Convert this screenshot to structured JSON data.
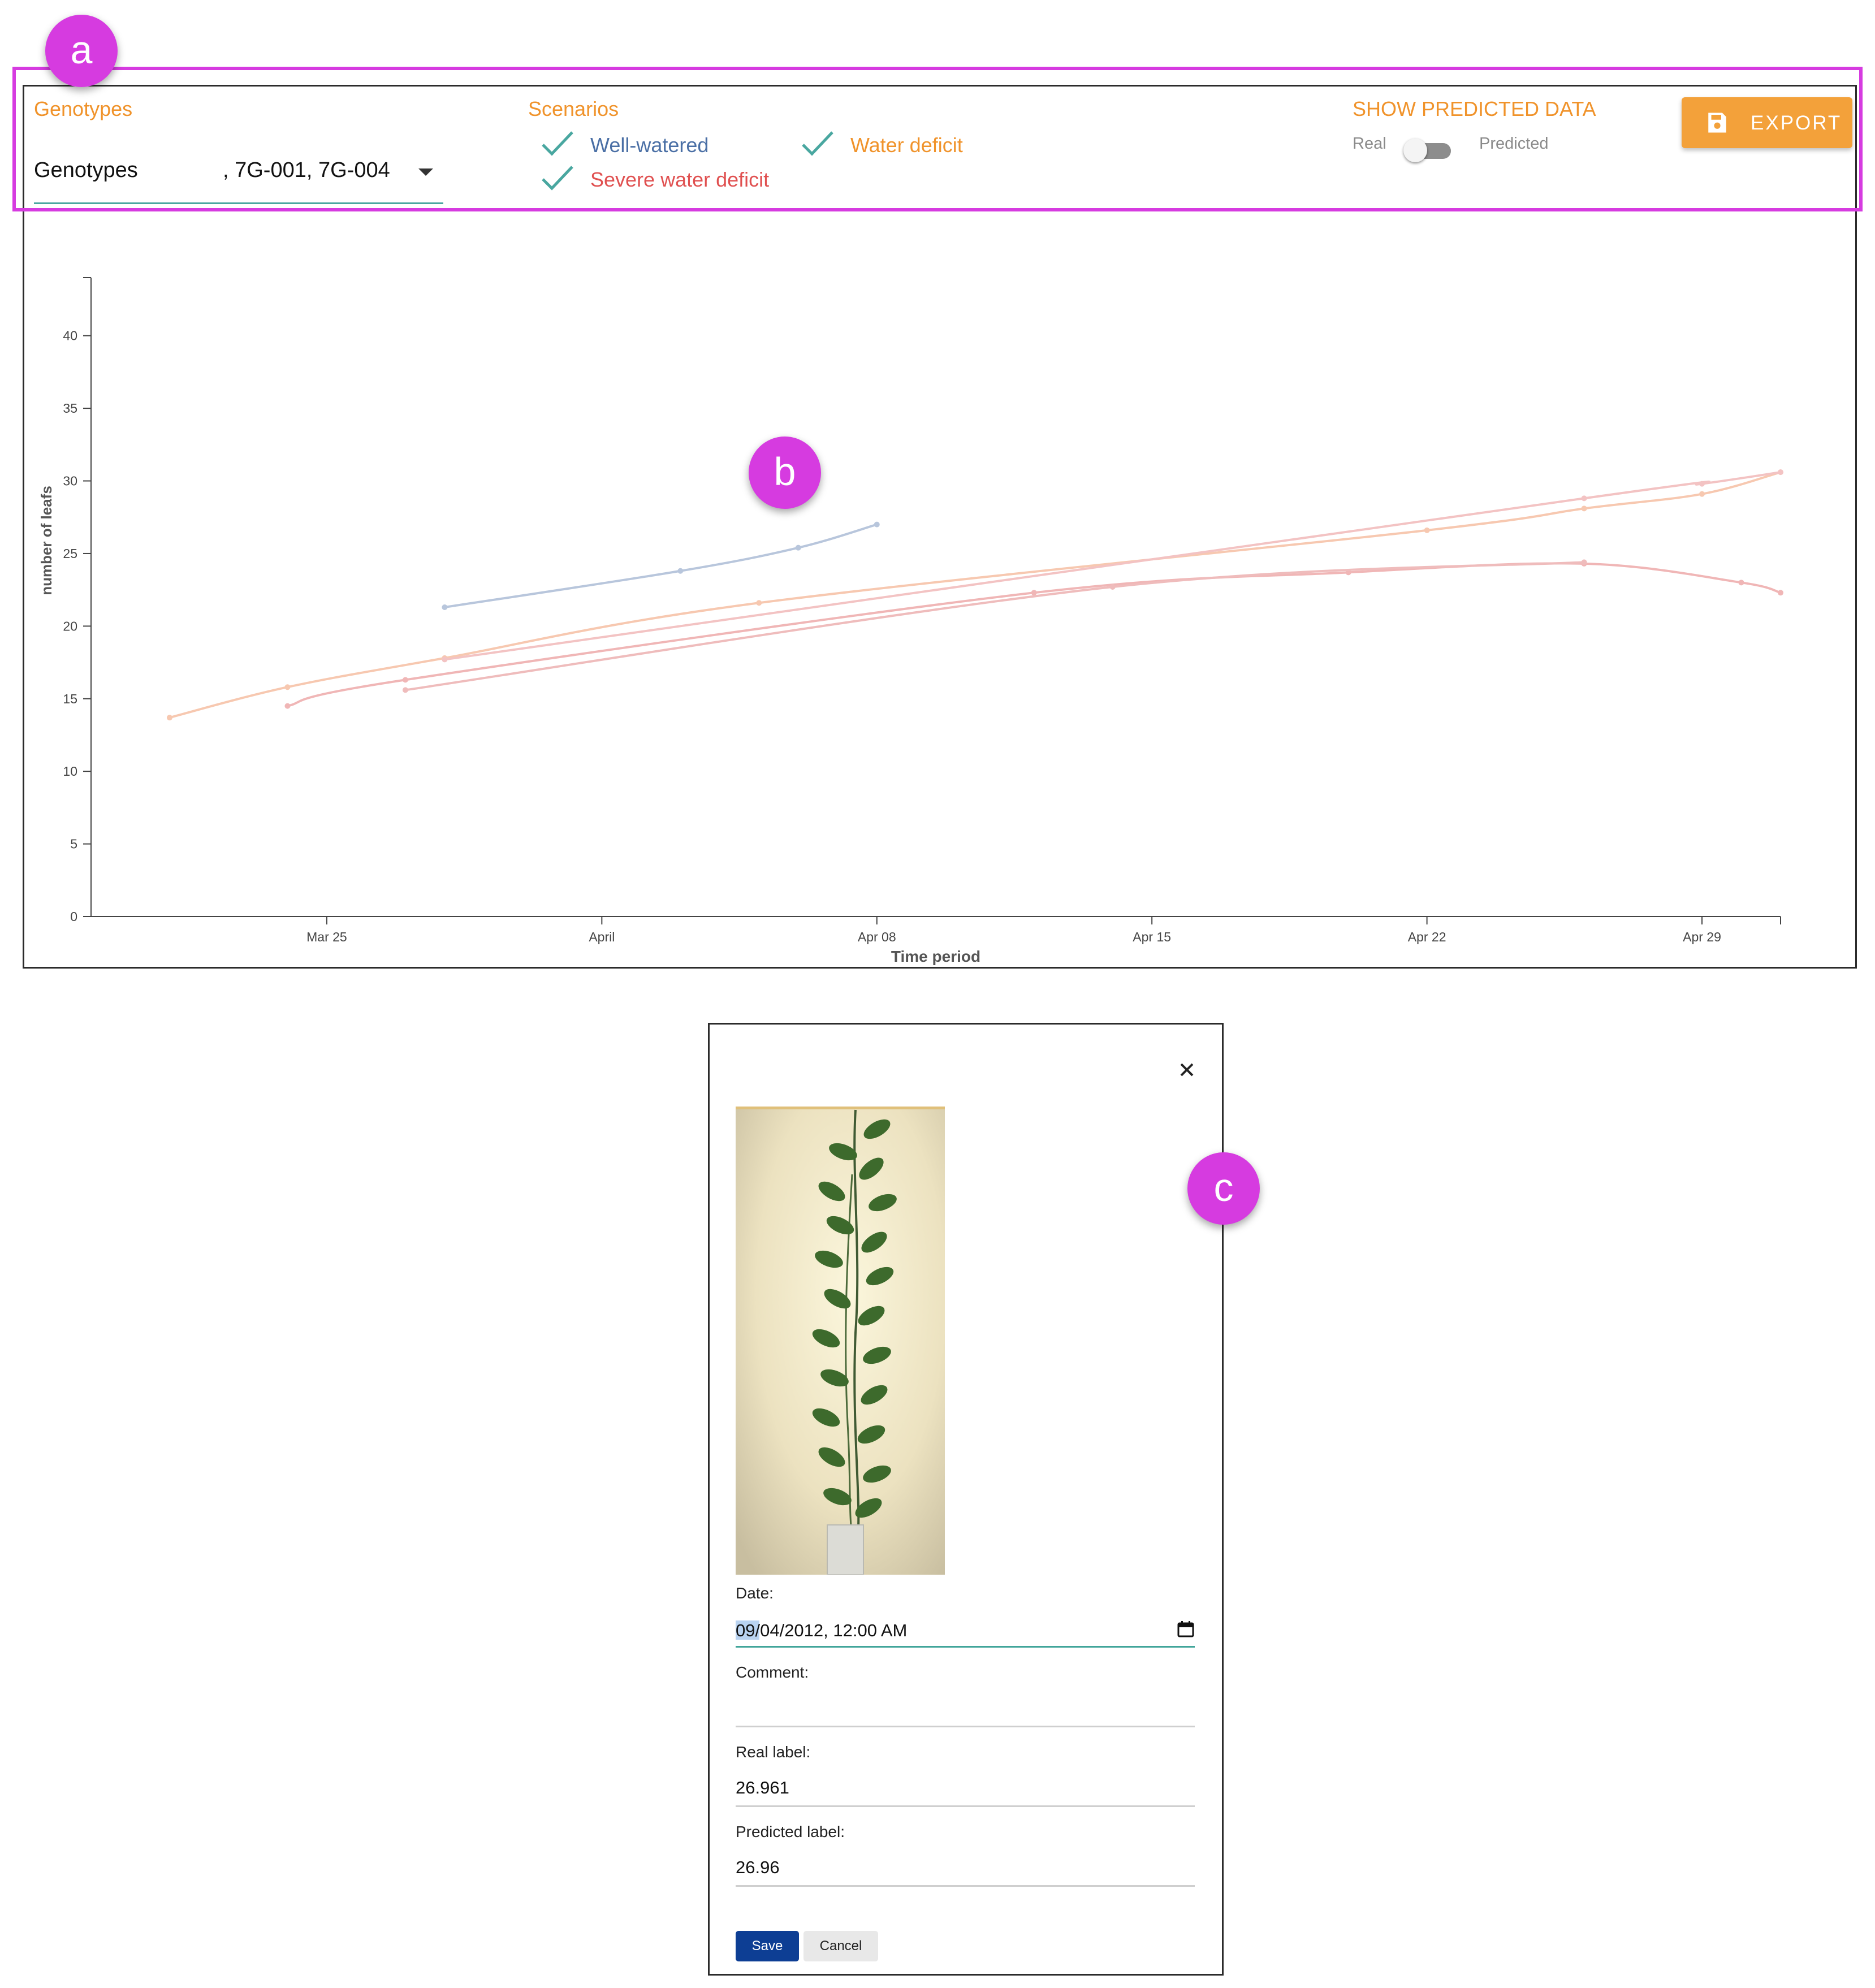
{
  "markers": {
    "a": "a",
    "b": "b",
    "c": "c"
  },
  "controls": {
    "genotypes_label": "Genotypes",
    "genotype_select": {
      "value_prefix": "Genotypes",
      "value_rest": ", 7G-001, 7G-004"
    },
    "scenarios_label": "Scenarios",
    "scenarios": [
      {
        "label": "Well-watered",
        "color": "#4a6fa5",
        "checked": true
      },
      {
        "label": "Water deficit",
        "color": "#f0932b",
        "checked": true
      },
      {
        "label": "Severe water deficit",
        "color": "#e05050",
        "checked": true
      }
    ],
    "predicted_title": "SHOW PREDICTED DATA",
    "toggle_left": "Real",
    "toggle_right": "Predicted",
    "toggle_on": false,
    "export_label": "EXPORT"
  },
  "chart_data": {
    "type": "line",
    "xlabel": "Time period",
    "ylabel": "number of leafs",
    "ylim": [
      0,
      44
    ],
    "yticks": [
      0,
      5,
      10,
      15,
      20,
      25,
      30,
      35,
      40
    ],
    "xlim": [
      "2012-03-19",
      "2012-05-01"
    ],
    "xticks": [
      {
        "date": "2012-03-25",
        "label": "Mar 25"
      },
      {
        "date": "2012-04-01",
        "label": "April"
      },
      {
        "date": "2012-04-08",
        "label": "Apr 08"
      },
      {
        "date": "2012-04-15",
        "label": "Apr 15"
      },
      {
        "date": "2012-04-22",
        "label": "Apr 22"
      },
      {
        "date": "2012-04-29",
        "label": "Apr 29"
      }
    ],
    "series": [
      {
        "color": "#b8c6dc",
        "points": [
          [
            "2012-03-28",
            21.3
          ],
          [
            "2012-04-03",
            23.8
          ],
          [
            "2012-04-06",
            25.4
          ],
          [
            "2012-04-08",
            27.0
          ]
        ]
      },
      {
        "color": "#f7c8b0",
        "points": [
          [
            "2012-03-21",
            13.7
          ],
          [
            "2012-03-24",
            15.8
          ],
          [
            "2012-03-28",
            17.8
          ],
          [
            "2012-04-05",
            21.6
          ],
          [
            "2012-04-22",
            26.6
          ],
          [
            "2012-04-26",
            28.1
          ],
          [
            "2012-04-29",
            29.1
          ],
          [
            "2012-05-01",
            30.6
          ]
        ]
      },
      {
        "color": "#f0b6b6",
        "points": [
          [
            "2012-03-24",
            14.5
          ],
          [
            "2012-03-27",
            16.3
          ],
          [
            "2012-04-12",
            22.3
          ],
          [
            "2012-04-20",
            23.7
          ],
          [
            "2012-04-26",
            24.3
          ],
          [
            "2012-04-30",
            23.0
          ],
          [
            "2012-05-01",
            22.3
          ]
        ]
      },
      {
        "color": "#efbcbc",
        "points": [
          [
            "2012-03-27",
            15.6
          ],
          [
            "2012-04-14",
            22.7
          ],
          [
            "2012-04-26",
            24.4
          ]
        ]
      },
      {
        "color": "#f3c3c3",
        "points": [
          [
            "2012-03-28",
            17.7
          ],
          [
            "2012-04-26",
            28.8
          ],
          [
            "2012-04-29",
            29.8
          ],
          [
            "2012-05-01",
            30.6
          ]
        ]
      }
    ]
  },
  "dialog": {
    "date_label": "Date:",
    "date_value": "09/04/2012, 12:00 AM",
    "comment_label": "Comment:",
    "comment_value": "",
    "real_label": "Real label:",
    "real_value": "26.961",
    "predicted_label": "Predicted label:",
    "predicted_value": "26.96",
    "save": "Save",
    "cancel": "Cancel"
  }
}
